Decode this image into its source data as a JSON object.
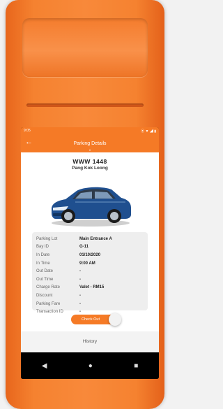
{
  "status_bar": {
    "time": "9:05",
    "icons": "⦿ ▼ ◢ ▮"
  },
  "app_bar": {
    "back_icon": "arrow-left-icon",
    "title": "Parking Details",
    "chevron_icon": "chevron-down-icon"
  },
  "vehicle": {
    "plate": "WWW 1448",
    "owner": "Pang Kok Loong"
  },
  "details": [
    {
      "label": "Parking Lot",
      "value": "Main Entrance A"
    },
    {
      "label": "Bay ID",
      "value": "G-11"
    },
    {
      "label": "In Date",
      "value": "01/10/2020"
    },
    {
      "label": "In Time",
      "value": "9:00 AM"
    },
    {
      "label": "Out Date",
      "value": "-"
    },
    {
      "label": "Out Time",
      "value": "-"
    },
    {
      "label": "Charge Rate",
      "value": "Valet - RM15"
    },
    {
      "label": "Discount",
      "value": "-"
    },
    {
      "label": "Parking Fare",
      "value": "-"
    },
    {
      "label": "Transaction ID",
      "value": "-"
    }
  ],
  "checkout_label": "Check Out",
  "history_label": "History",
  "nav": {
    "back": "◀",
    "home": "●",
    "recents": "■"
  },
  "colors": {
    "brand": "#f57a26",
    "device": "#f8893a"
  }
}
